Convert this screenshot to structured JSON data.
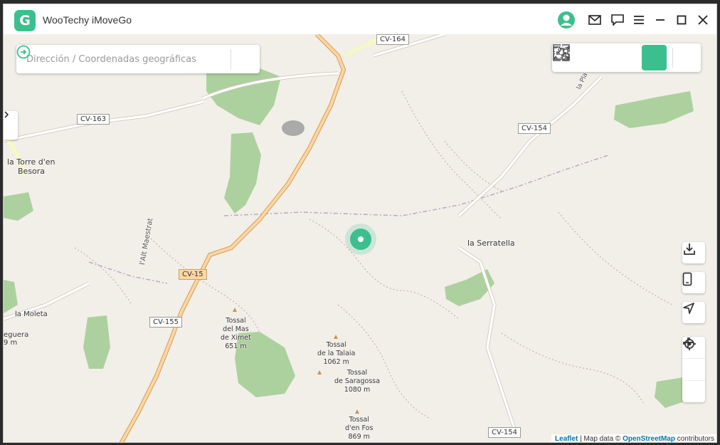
{
  "app": {
    "title": "WooTechy iMoveGo",
    "logo_letter": "G"
  },
  "titlebar": {
    "buttons": [
      {
        "name": "account",
        "icon": "user-avatar-icon"
      },
      {
        "name": "mail",
        "icon": "mail-icon"
      },
      {
        "name": "feedback",
        "icon": "chat-icon"
      },
      {
        "name": "menu",
        "icon": "menu-icon"
      },
      {
        "name": "minimize",
        "icon": "minimize-icon"
      },
      {
        "name": "maximize",
        "icon": "maximize-icon"
      },
      {
        "name": "close",
        "icon": "close-icon"
      }
    ]
  },
  "search": {
    "placeholder": "Dirección / Coordenadas geográficas",
    "value": ""
  },
  "modes": [
    {
      "name": "teleport-mode",
      "icon": "map-pin-mode-icon",
      "active": false
    },
    {
      "name": "two-spot-mode",
      "icon": "route-lines-icon",
      "active": false
    },
    {
      "name": "multi-spot-mode",
      "icon": "multi-path-icon",
      "active": false
    },
    {
      "name": "locate-mode",
      "icon": "crosshair-icon",
      "active": true
    },
    {
      "name": "history",
      "icon": "history-folder-icon",
      "active": false
    }
  ],
  "map": {
    "places": [
      {
        "name": "place-torre-den-besora",
        "text": "la Torre d'en",
        "text2": "Besora"
      },
      {
        "name": "place-serratella",
        "text": "la Serratella"
      },
      {
        "name": "place-moleta",
        "text": "la Moleta"
      },
      {
        "name": "place-eguera",
        "text": "eguera",
        "text2": "9 m"
      },
      {
        "name": "place-alt-maestrat",
        "text": "l'Alt Maestrat"
      },
      {
        "name": "place-la-pla",
        "text": "la Pla"
      }
    ],
    "peaks": [
      {
        "name": "peak-tossal-mas-ximet",
        "line1": "Tossal",
        "line2": "del Mas",
        "line3": "de Ximet",
        "elev": "651 m"
      },
      {
        "name": "peak-tossal-talaia",
        "line1": "Tossal",
        "line2": "de la Talaia",
        "elev": "1062 m"
      },
      {
        "name": "peak-tossal-saragossa",
        "line1": "Tossal",
        "line2": "de Saragossa",
        "elev": "1080 m"
      },
      {
        "name": "peak-tossal-en-fos",
        "line1": "Tossal",
        "line2": "d'en Fos",
        "elev": "869 m"
      }
    ],
    "roads": [
      "CV-164",
      "CV-163",
      "CV-154",
      "CV-15",
      "CV-155",
      "CV-154"
    ],
    "attribution": {
      "leaflet": "Leaflet",
      "mid": "| Map data ©",
      "osm": "OpenStreetMap",
      "tail": "contributors"
    },
    "colors": {
      "land": "#f2efe9",
      "forest": "#add19e",
      "major_road": "#f6b66d",
      "minor_road": "#ffffff",
      "marker": "#3cbf8f"
    }
  },
  "map_controls": [
    {
      "name": "download-button",
      "icon": "download-icon"
    },
    {
      "name": "device-button",
      "icon": "phone-icon"
    },
    {
      "name": "navigate-button",
      "icon": "navigation-arrow-icon"
    },
    {
      "name": "current-location-button",
      "icon": "target-location-icon"
    },
    {
      "name": "zoom-in-button",
      "icon": "plus-icon"
    },
    {
      "name": "zoom-out-button",
      "icon": "minus-icon"
    }
  ]
}
